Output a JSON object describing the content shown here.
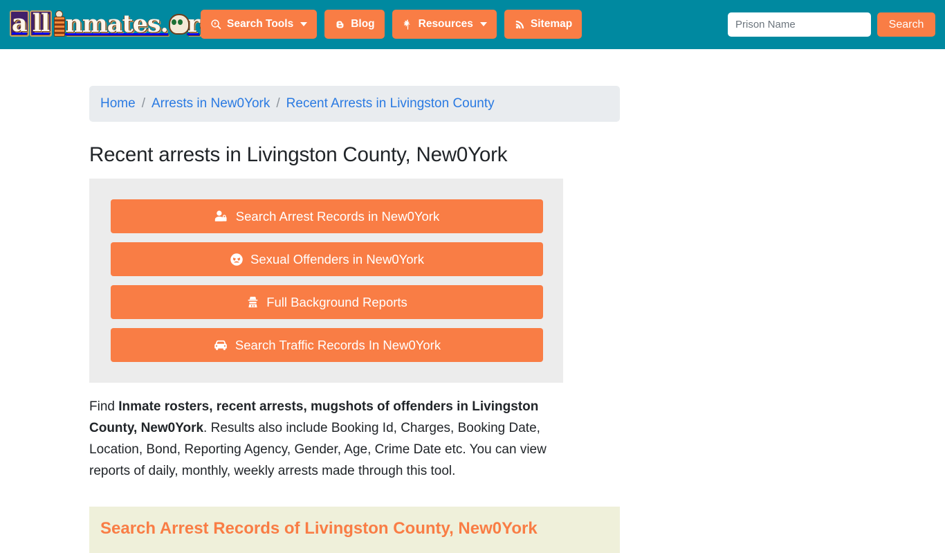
{
  "header": {
    "logo": {
      "name": "allInmates.org",
      "part_a": "a",
      "part_ll": "ll",
      "part_rest": "nmates.",
      "part_tld": "rg"
    },
    "nav": [
      {
        "label": "Search Tools",
        "icon": "search-bolt-icon",
        "has_caret": true
      },
      {
        "label": "Blog",
        "icon": "blogger-icon",
        "has_caret": false
      },
      {
        "label": "Resources",
        "icon": "leaf-icon",
        "has_caret": true
      },
      {
        "label": "Sitemap",
        "icon": "rss-icon",
        "has_caret": false
      }
    ],
    "search": {
      "placeholder": "Prison Name",
      "value": "",
      "button_label": "Search"
    }
  },
  "breadcrumb": {
    "separator": "/",
    "items": [
      {
        "label": "Home"
      },
      {
        "label": "Arrests in New0York"
      },
      {
        "label": "Recent Arrests in Livingston County"
      }
    ]
  },
  "main": {
    "page_title": "Recent arrests in Livingston County, New0York",
    "actions": [
      {
        "label": "Search Arrest Records in New0York",
        "icon": "user-lock-icon"
      },
      {
        "label": "Sexual Offenders in New0York",
        "icon": "angry-face-icon"
      },
      {
        "label": "Full Background Reports",
        "icon": "detective-icon"
      },
      {
        "label": "Search Traffic Records In New0York",
        "icon": "car-icon"
      }
    ],
    "paragraph": {
      "prefix": "Find ",
      "bold": "Inmate rosters, recent arrests, mugshots of offenders in Livingston County, New0York",
      "suffix": ". Results also include Booking Id, Charges, Booking Date, Location, Bond, Reporting Agency, Gender, Age, Crime Date etc. You can view reports of daily, monthly, weekly arrests made through this tool."
    },
    "cream_heading": "Search Arrest Records of Livingston County, New0York"
  },
  "colors": {
    "header_teal": "#0089a0",
    "accent_orange": "#f97d45",
    "link_blue": "#2a7ae2",
    "panel_gray": "#ececec",
    "breadcrumb_gray": "#e9ecef",
    "cream": "#eff0da"
  }
}
